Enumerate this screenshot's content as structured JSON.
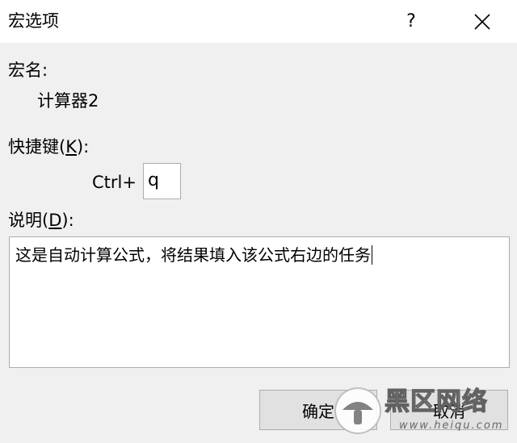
{
  "window": {
    "title": "宏选项",
    "help_label": "?"
  },
  "macro": {
    "name_label": "宏名:",
    "name_value": "计算器2"
  },
  "shortcut": {
    "label_prefix": "快捷键(",
    "label_accel": "K",
    "label_suffix": "):",
    "ctrl_prefix": "Ctrl+",
    "value": "q"
  },
  "description": {
    "label_prefix": "说明(",
    "label_accel": "D",
    "label_suffix": "):",
    "value": "这是自动计算公式，将结果填入该公式右边的任务"
  },
  "buttons": {
    "ok_label": "确定",
    "cancel_label": "取消"
  },
  "watermark": {
    "text": "黑区网络",
    "url": "www.heiqu.com"
  }
}
